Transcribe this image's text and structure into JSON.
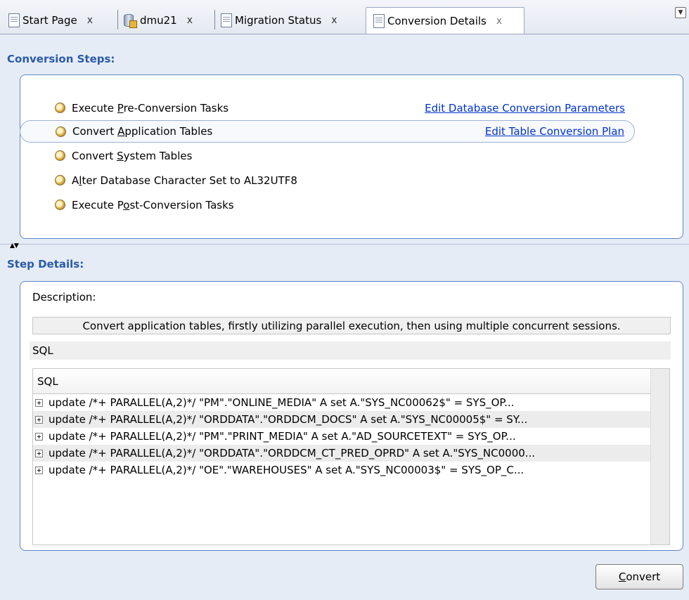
{
  "tabs": [
    {
      "label": "Start Page",
      "icon": "document-icon",
      "close": "x",
      "active": false
    },
    {
      "label": "dmu21",
      "icon": "database-icon",
      "close": "x",
      "active": false
    },
    {
      "label": "Migration Status",
      "icon": "document-icon",
      "close": "x",
      "active": false
    },
    {
      "label": "Conversion Details",
      "icon": "document-icon",
      "close": "x",
      "active": true
    }
  ],
  "conversion_steps": {
    "title": "Conversion Steps:",
    "steps": [
      {
        "pre": "Execute ",
        "mnemonic": "P",
        "post": "re-Conversion Tasks",
        "link": "Edit Database Conversion Parameters"
      },
      {
        "pre": "Convert ",
        "mnemonic": "A",
        "post": "pplication Tables",
        "link": "Edit Table Conversion Plan",
        "selected": true
      },
      {
        "pre": "Convert ",
        "mnemonic": "S",
        "post": "ystem Tables"
      },
      {
        "pre": "A",
        "mnemonic": "l",
        "post": "ter Database Character Set to AL32UTF8"
      },
      {
        "pre": "Execute P",
        "mnemonic": "o",
        "post": "st-Conversion Tasks"
      }
    ]
  },
  "step_details": {
    "title": "Step Details:",
    "description_label": "Description:",
    "description": "Convert application tables, firstly utilizing parallel execution, then using multiple concurrent sessions.",
    "sql_label": "SQL",
    "grid_header": "SQL",
    "rows": [
      "update  /*+ PARALLEL(A,2)*/ \"PM\".\"ONLINE_MEDIA\" A  set A.\"SYS_NC00062$\" = SYS_OP...",
      "update  /*+ PARALLEL(A,2)*/ \"ORDDATA\".\"ORDDCM_DOCS\" A  set A.\"SYS_NC00005$\" = SY...",
      "update  /*+ PARALLEL(A,2)*/ \"PM\".\"PRINT_MEDIA\" A  set A.\"AD_SOURCETEXT\" = SYS_OP...",
      "update  /*+ PARALLEL(A,2)*/ \"ORDDATA\".\"ORDDCM_CT_PRED_OPRD\" A  set A.\"SYS_NC0000...",
      "update  /*+ PARALLEL(A,2)*/ \"OE\".\"WAREHOUSES\" A  set A.\"SYS_NC00003$\" = SYS_OP_C..."
    ]
  },
  "convert_button": {
    "mnemonic": "C",
    "rest": "onvert"
  },
  "colors": {
    "section_title": "#2b5ba8",
    "link": "#0033cc",
    "panel_border": "#5b86c8"
  }
}
